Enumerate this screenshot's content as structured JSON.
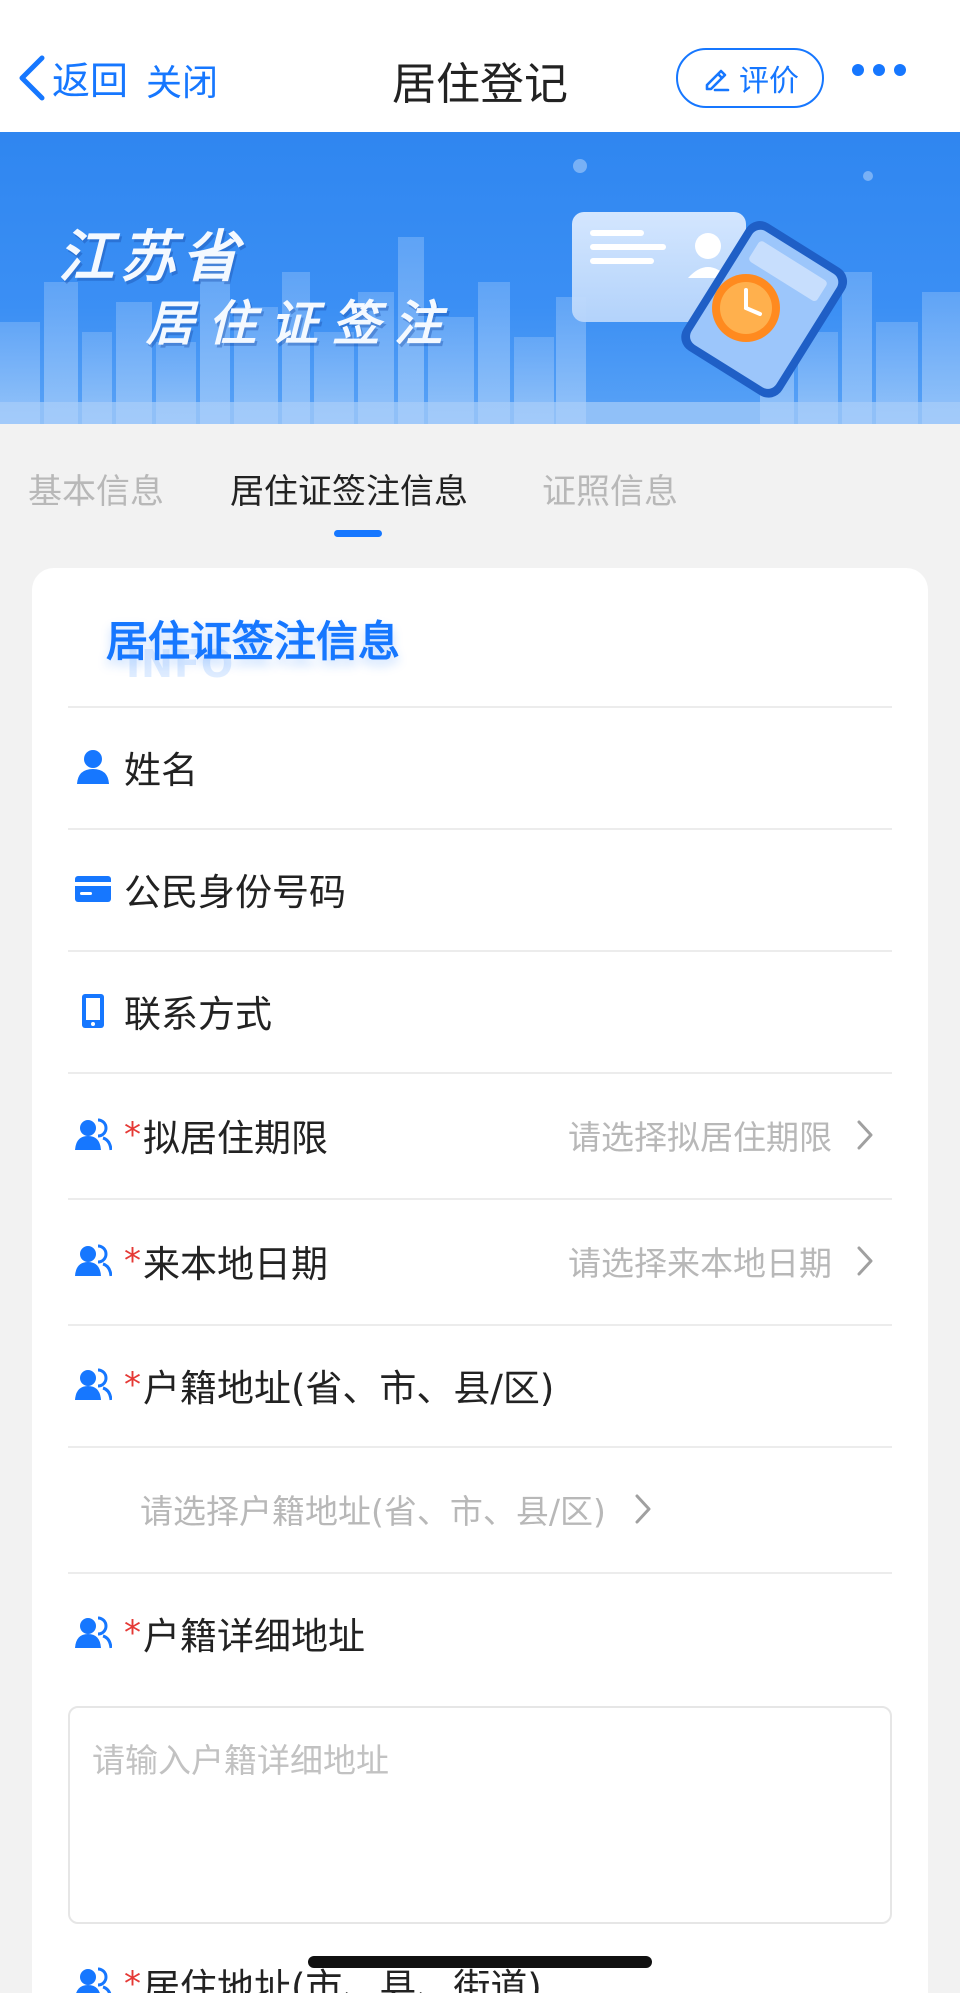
{
  "nav": {
    "back_label": "返回",
    "close_label": "关闭",
    "title": "居住登记",
    "rate_label": "评价"
  },
  "banner": {
    "province": "江苏省",
    "subtitle": "居住证签注"
  },
  "tabs": [
    {
      "label": "基本信息",
      "active": false
    },
    {
      "label": "居住证签注信息",
      "active": true
    },
    {
      "label": "证照信息",
      "active": false
    }
  ],
  "card": {
    "title": "居住证签注信息",
    "watermark": "INFO",
    "fields": {
      "name": {
        "label": "姓名",
        "icon": "person-icon"
      },
      "id_number": {
        "label": "公民身份号码",
        "icon": "id-card-icon"
      },
      "contact": {
        "label": "联系方式",
        "icon": "phone-icon"
      },
      "residence_period": {
        "required_mark": "*",
        "label": "拟居住期限",
        "placeholder": "请选择拟居住期限",
        "icon": "people-icon"
      },
      "arrival_date": {
        "required_mark": "*",
        "label": "来本地日期",
        "placeholder": "请选择来本地日期",
        "icon": "people-icon"
      },
      "hukou_address": {
        "required_mark": "*",
        "label": "户籍地址(省、市、县/区)",
        "placeholder": "请选择户籍地址(省、市、县/区)",
        "icon": "people-icon"
      },
      "hukou_detail": {
        "required_mark": "*",
        "label": "户籍详细地址",
        "placeholder": "请输入户籍详细地址",
        "icon": "people-icon"
      },
      "residence_address": {
        "required_mark": "*",
        "label": "居住地址(市、县、街道)",
        "icon": "people-icon"
      }
    }
  },
  "colors": {
    "accent": "#1677ff",
    "required": "#e53935",
    "placeholder": "#b8b8b8"
  }
}
